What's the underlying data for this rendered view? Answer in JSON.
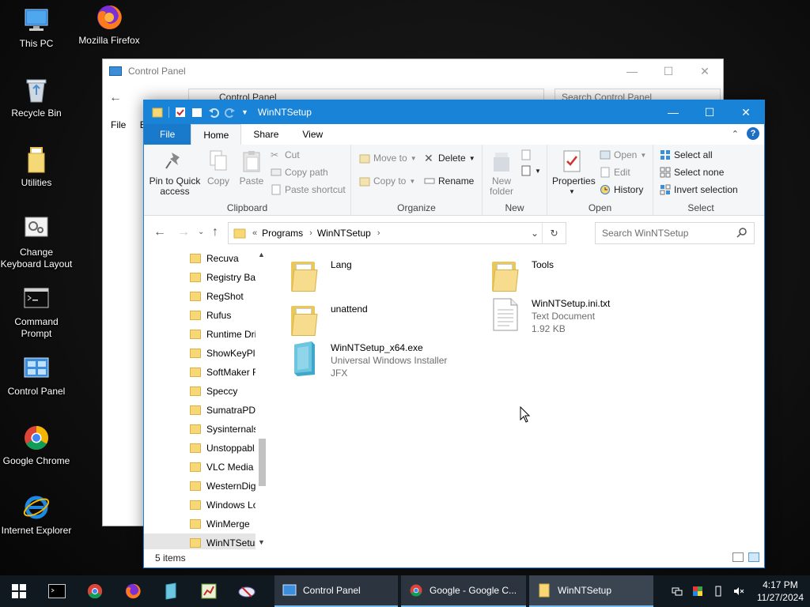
{
  "desktop": {
    "icons": [
      {
        "label": "This PC"
      },
      {
        "label": "Mozilla Firefox"
      },
      {
        "label": "Recycle Bin"
      },
      {
        "label": "Utilities"
      },
      {
        "label": "Change Keyboard Layout"
      },
      {
        "label": "Command Prompt"
      },
      {
        "label": "Control Panel"
      },
      {
        "label": "Google Chrome"
      },
      {
        "label": "Internet Explorer"
      }
    ]
  },
  "control_panel": {
    "title": "Control Panel",
    "address": "Control Panel",
    "search_placeholder": "Search Control Panel",
    "menu_file": "File",
    "menu_edit": "E"
  },
  "explorer": {
    "title": "WinNTSetup",
    "tabs": {
      "file": "File",
      "home": "Home",
      "share": "Share",
      "view": "View"
    },
    "ribbon": {
      "clipboard": {
        "label": "Clipboard",
        "pin": "Pin to Quick access",
        "copy": "Copy",
        "paste": "Paste",
        "cut": "Cut",
        "copy_path": "Copy path",
        "paste_shortcut": "Paste shortcut"
      },
      "organize": {
        "label": "Organize",
        "move_to": "Move to",
        "copy_to": "Copy to",
        "delete": "Delete",
        "rename": "Rename"
      },
      "new": {
        "label": "New",
        "new_folder": "New folder"
      },
      "open": {
        "label": "Open",
        "properties": "Properties",
        "open": "Open",
        "edit": "Edit",
        "history": "History"
      },
      "select": {
        "label": "Select",
        "select_all": "Select all",
        "select_none": "Select none",
        "invert": "Invert selection"
      }
    },
    "address": {
      "prefix": "«",
      "crumbs": [
        "Programs",
        "WinNTSetup"
      ]
    },
    "search_placeholder": "Search WinNTSetup",
    "nav_items": [
      {
        "label": "Recuva"
      },
      {
        "label": "Registry Bac"
      },
      {
        "label": "RegShot"
      },
      {
        "label": "Rufus"
      },
      {
        "label": "Runtime Dri"
      },
      {
        "label": "ShowKeyPlu"
      },
      {
        "label": "SoftMaker F"
      },
      {
        "label": "Speccy"
      },
      {
        "label": "SumatraPDF"
      },
      {
        "label": "Sysinternals"
      },
      {
        "label": "Unstoppabl"
      },
      {
        "label": "VLC Media I"
      },
      {
        "label": "WesternDig"
      },
      {
        "label": "Windows Lo"
      },
      {
        "label": "WinMerge"
      },
      {
        "label": "WinNTSetup"
      }
    ],
    "files": [
      {
        "name": "Lang",
        "line2": "",
        "line3": ""
      },
      {
        "name": "Tools",
        "line2": "",
        "line3": ""
      },
      {
        "name": "unattend",
        "line2": "",
        "line3": ""
      },
      {
        "name": "WinNTSetup.ini.txt",
        "line2": "Text Document",
        "line3": "1.92 KB"
      },
      {
        "name": "WinNTSetup_x64.exe",
        "line2": "Universal Windows Installer",
        "line3": "JFX"
      }
    ],
    "status": "5 items"
  },
  "taskbar": {
    "apps": [
      {
        "label": "Control Panel"
      },
      {
        "label": "Google - Google C..."
      },
      {
        "label": "WinNTSetup"
      }
    ],
    "time": "4:17 PM",
    "date": "11/27/2024"
  },
  "colors": {
    "accent": "#1883d7",
    "taskbar": "#101820",
    "folder": "#f8d775"
  }
}
